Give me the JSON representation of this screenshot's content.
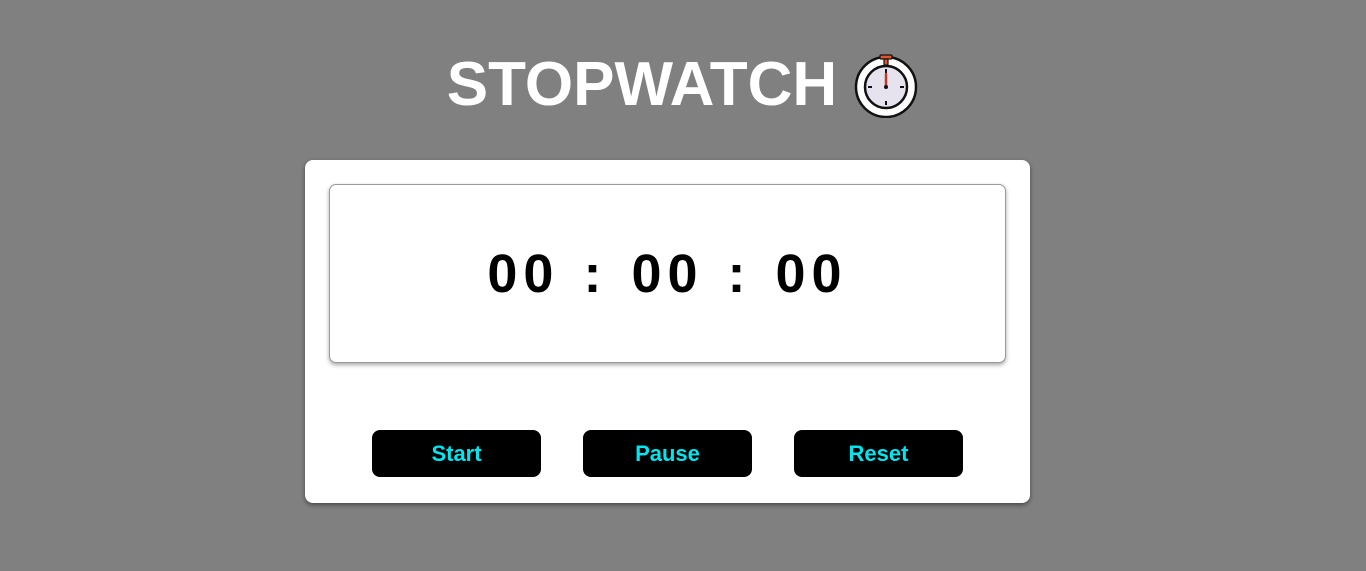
{
  "header": {
    "title": "STOPWATCH",
    "icon": "stopwatch-icon"
  },
  "timer": {
    "hours": "00",
    "minutes": "00",
    "seconds": "00",
    "separator": ":"
  },
  "controls": {
    "start_label": "Start",
    "pause_label": "Pause",
    "reset_label": "Reset"
  },
  "colors": {
    "background": "#808080",
    "card": "#ffffff",
    "button_bg": "#000000",
    "button_text": "#00e5ee",
    "title": "#ffffff"
  }
}
